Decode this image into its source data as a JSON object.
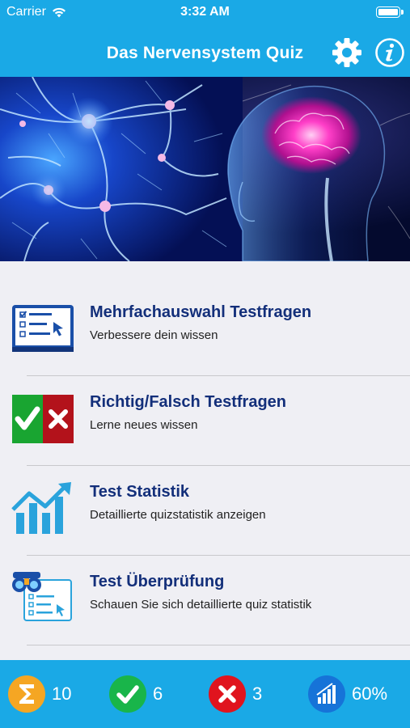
{
  "status_bar": {
    "carrier": "Carrier",
    "time": "3:32 AM"
  },
  "nav": {
    "title": "Das Nervensystem Quiz"
  },
  "menu": [
    {
      "title": "Mehrfachauswahl Testfragen",
      "subtitle": "Verbessere dein wissen",
      "icon": "multiple-choice-icon"
    },
    {
      "title": "Richtig/Falsch Testfragen",
      "subtitle": "Lerne neues wissen",
      "icon": "true-false-icon"
    },
    {
      "title": "Test Statistik",
      "subtitle": "Detaillierte quizstatistik anzeigen",
      "icon": "statistics-chart-icon"
    },
    {
      "title": "Test Überprüfung",
      "subtitle": "Schauen Sie sich detaillierte quiz statistik",
      "icon": "review-binoculars-icon"
    }
  ],
  "footer": {
    "total": "10",
    "correct": "6",
    "wrong": "3",
    "percent": "60%"
  },
  "colors": {
    "header": "#1aa9e6",
    "title_text": "#132f7a",
    "correct": "#19b54a",
    "wrong": "#e0141e",
    "total": "#f5a623",
    "percent": "#1673d8"
  }
}
